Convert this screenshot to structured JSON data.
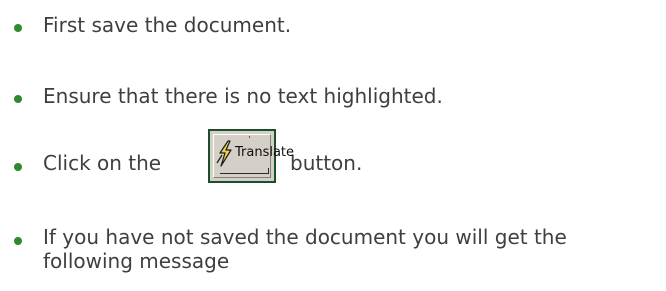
{
  "items": [
    {
      "text": "First save the document."
    },
    {
      "text": "Ensure that there is no text highlighted."
    },
    {
      "prefix": "Click on the",
      "suffix": "button."
    },
    {
      "line1": "If you have not saved the document you will get the",
      "line2": "following message"
    }
  ],
  "translate_button": {
    "label": "Translate",
    "icon": "lightning-icon"
  },
  "colors": {
    "bullet": "#2d8a2d",
    "text": "#3f3f3f",
    "button_face": "#d4d0c8",
    "frame_border": "#1b4f2a",
    "bolt_fill": "#e8d24a"
  }
}
